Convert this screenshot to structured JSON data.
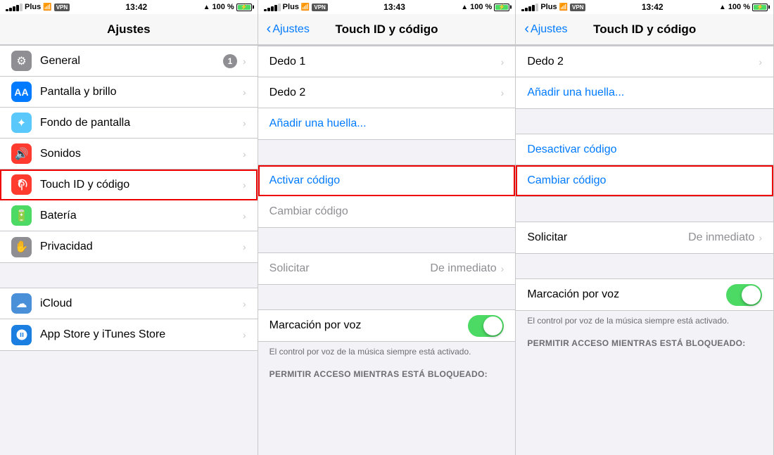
{
  "panels": [
    {
      "id": "panel1",
      "status": {
        "carrier": "Plus",
        "wifi": true,
        "vpn": "VPN",
        "time": "13:42",
        "gps": true,
        "battery_pct": "100 %",
        "charging": true
      },
      "nav": {
        "title": "Ajustes",
        "back": null
      },
      "items": [
        {
          "icon": "gear",
          "icon_class": "icon-gray",
          "label": "General",
          "badge": "1",
          "has_chevron": true,
          "highlighted": false
        },
        {
          "icon": "AA",
          "icon_class": "icon-blue-aa",
          "label": "Pantalla y brillo",
          "badge": null,
          "has_chevron": true,
          "highlighted": false
        },
        {
          "icon": "✦",
          "icon_class": "icon-teal",
          "label": "Fondo de pantalla",
          "badge": null,
          "has_chevron": true,
          "highlighted": false
        },
        {
          "icon": "🔊",
          "icon_class": "icon-red",
          "label": "Sonidos",
          "badge": null,
          "has_chevron": true,
          "highlighted": false
        },
        {
          "icon": "👆",
          "icon_class": "icon-red-touch",
          "label": "Touch ID y código",
          "badge": null,
          "has_chevron": true,
          "highlighted": true
        },
        {
          "icon": "🔋",
          "icon_class": "icon-green",
          "label": "Batería",
          "badge": null,
          "has_chevron": true,
          "highlighted": false
        },
        {
          "icon": "✋",
          "icon_class": "icon-gray-hand",
          "label": "Privacidad",
          "badge": null,
          "has_chevron": true,
          "highlighted": false
        }
      ],
      "items2": [
        {
          "icon": "☁",
          "icon_class": "icon-cloud",
          "label": "iCloud",
          "has_chevron": true
        },
        {
          "icon": "A",
          "icon_class": "icon-store",
          "label": "App Store y iTunes Store",
          "has_chevron": true
        }
      ]
    },
    {
      "id": "panel2",
      "status": {
        "carrier": "Plus",
        "wifi": true,
        "vpn": "VPN",
        "time": "13:43",
        "gps": true,
        "battery_pct": "100 %",
        "charging": true
      },
      "nav": {
        "back_label": "Ajustes",
        "title": "Touch ID y código"
      },
      "fingerprints": [
        {
          "label": "Dedo 1",
          "highlighted": false
        },
        {
          "label": "Dedo 2",
          "highlighted": false
        }
      ],
      "add_fingerprint": "Añadir una huella...",
      "code_section": [
        {
          "label": "Activar código",
          "highlighted": true,
          "blue": true,
          "gray": false
        },
        {
          "label": "Cambiar código",
          "highlighted": false,
          "blue": false,
          "gray": true
        }
      ],
      "solicitar_label": "Solicitar",
      "solicitar_value": "De inmediato",
      "voice_label": "Marcación por voz",
      "voice_on": true,
      "voice_note": "El control por voz de la música siempre está activado.",
      "permit_label": "PERMITIR ACCESO MIENTRAS ESTÁ BLOQUEADO:"
    },
    {
      "id": "panel3",
      "status": {
        "carrier": "Plus",
        "wifi": true,
        "vpn": "VPN",
        "time": "13:42",
        "gps": true,
        "battery_pct": "100 %",
        "charging": true
      },
      "nav": {
        "back_label": "Ajustes",
        "title": "Touch ID y código"
      },
      "fingerprints": [
        {
          "label": "Dedo 2",
          "highlighted": false
        }
      ],
      "add_fingerprint": "Añadir una huella...",
      "code_section": [
        {
          "label": "Desactivar código",
          "highlighted": false,
          "blue": true,
          "gray": false
        },
        {
          "label": "Cambiar código",
          "highlighted": true,
          "blue": true,
          "gray": false
        }
      ],
      "solicitar_label": "Solicitar",
      "solicitar_value": "De inmediato",
      "voice_label": "Marcación por voz",
      "voice_on": true,
      "voice_note": "El control por voz de la música siempre está activado.",
      "permit_label": "PERMITIR ACCESO MIENTRAS ESTÁ BLOQUEADO:"
    }
  ]
}
